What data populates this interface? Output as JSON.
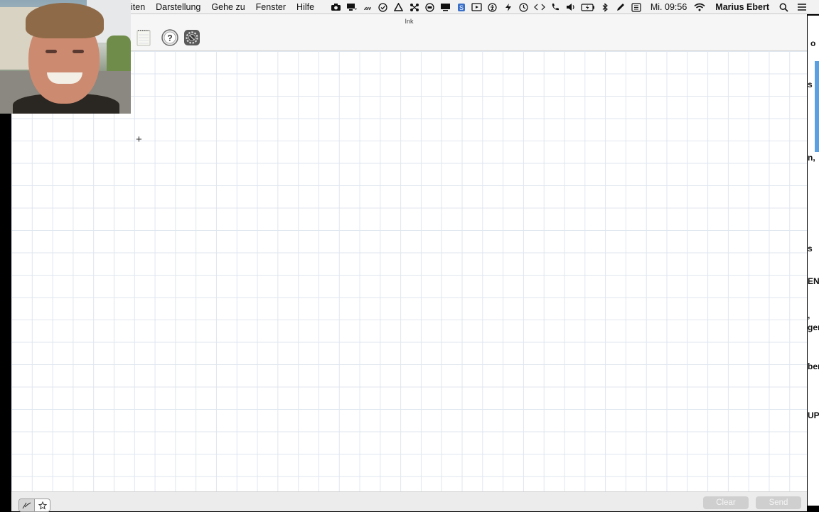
{
  "menubar": {
    "menus": [
      "iten",
      "Darstellung",
      "Gehe zu",
      "Fenster",
      "Hilfe"
    ],
    "clock": "Mi. 09:56",
    "user": "Marius Ebert"
  },
  "window": {
    "title": "Ink",
    "toolbar": {
      "notes_icon": "notepad-icon",
      "help_icon": "help-icon",
      "settings_icon": "gear-icon"
    },
    "bottom": {
      "clear_label": "Clear",
      "send_label": "Send"
    }
  },
  "background_fragments": [
    "o",
    "s",
    "n,",
    "",
    "s",
    "EN",
    ",",
    "ger",
    "ben",
    "UP"
  ],
  "colors": {
    "grid": "#dfe6ee",
    "menubar": "#f2f2f2",
    "disabled_button": "#cfcfcf"
  }
}
